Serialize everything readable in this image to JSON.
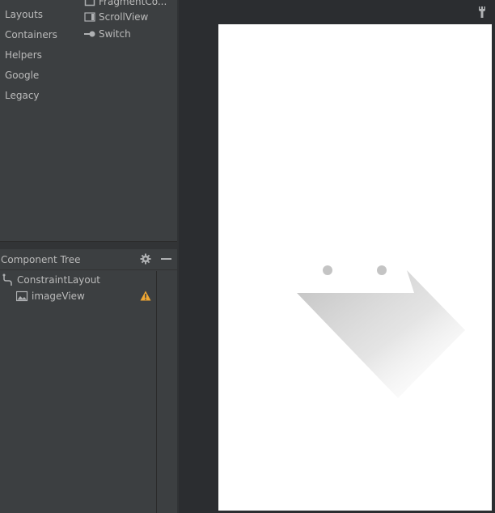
{
  "palette": {
    "categories": [
      "Layouts",
      "Containers",
      "Helpers",
      "Google",
      "Legacy"
    ],
    "items": [
      {
        "label": "FragmentCo...",
        "icon": "fragment-icon"
      },
      {
        "label": "ScrollView",
        "icon": "scrollview-icon"
      },
      {
        "label": "Switch",
        "icon": "switch-icon"
      }
    ]
  },
  "component_tree": {
    "title": "Component Tree",
    "nodes": [
      {
        "label": "ConstraintLayout",
        "icon": "constraint-layout-icon"
      },
      {
        "label": "imageView",
        "icon": "image-icon",
        "warning": true
      }
    ]
  },
  "colors": {
    "panel_bg": "#3c3f41",
    "editor_bg": "#2b2d30",
    "text": "#bbbbbb",
    "warning": "#f0a732",
    "canvas": "#ffffff"
  }
}
